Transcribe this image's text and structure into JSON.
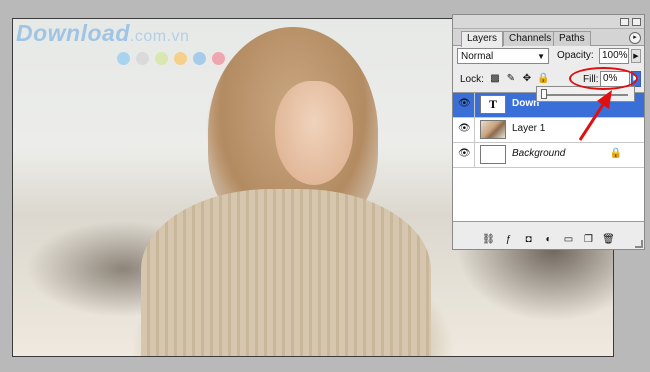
{
  "watermark": {
    "brand": "Download",
    "tld": ".com.vn",
    "dot_colors": [
      "#a8d4f0",
      "#dadada",
      "#d9e7b0",
      "#f5d08a",
      "#a6cce9",
      "#f0a6b0"
    ]
  },
  "panel": {
    "tabs": [
      "Layers",
      "Channels",
      "Paths"
    ],
    "menu_icon": "▸",
    "blend_mode": "Normal",
    "opacity_label": "Opacity:",
    "opacity_value": "100%",
    "lock_label": "Lock:",
    "lock_icons": [
      "lock-transparent-icon",
      "lock-brush-icon",
      "lock-move-icon",
      "lock-all-icon"
    ],
    "fill_label": "Fill:",
    "fill_value": "0%",
    "fill_slider_level": 0,
    "layers": [
      {
        "name": "Down",
        "thumb": "T",
        "type": "text",
        "selected": true
      },
      {
        "name": "Layer 1",
        "thumb": "",
        "type": "image",
        "selected": false
      },
      {
        "name": "Background",
        "thumb": "",
        "type": "background",
        "selected": false,
        "locked": true
      }
    ],
    "bottom_icons": [
      "link-layers-icon",
      "layer-style-icon",
      "layer-mask-icon",
      "adjustment-layer-icon",
      "new-group-icon",
      "new-layer-icon",
      "delete-layer-icon"
    ]
  },
  "highlight_color": "#e01010",
  "selection_color": "#3b6fd8"
}
